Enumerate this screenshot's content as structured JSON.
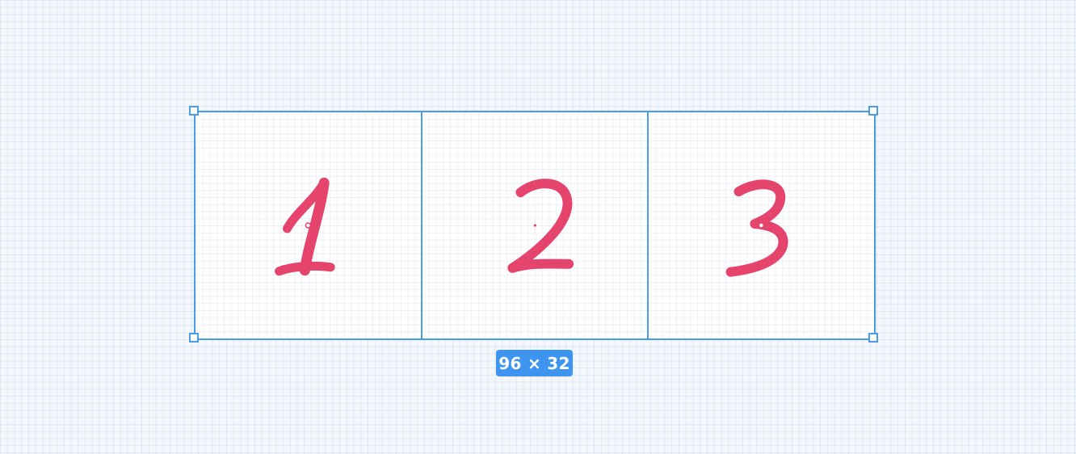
{
  "selection": {
    "size_label": "96 × 32",
    "accent_color": "#4a9be8",
    "badge_color": "#3d95f0"
  },
  "slots": [
    {
      "glyph": "1"
    },
    {
      "glyph": "2"
    },
    {
      "glyph": "3"
    }
  ],
  "stroke_color": "#e5456c"
}
